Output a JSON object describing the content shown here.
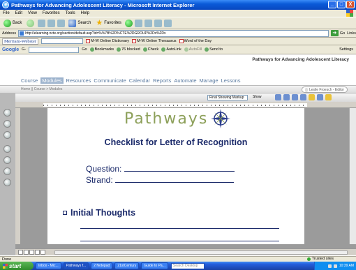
{
  "window": {
    "title": "Pathways for Advancing Adolescent Literacy - Microsoft Internet Explorer",
    "buttons": [
      "_",
      "□",
      "X"
    ]
  },
  "menu": [
    "File",
    "Edit",
    "View",
    "Favorites",
    "Tools",
    "Help"
  ],
  "toolbar": {
    "back": "Back",
    "search": "Search",
    "favorites": "Favorites"
  },
  "address": {
    "label": "Address",
    "url": "http://elearning.ncte.org/section/default.asp?id=%%7B%2D%CTE%2DGROUP%2Dx%2Dx",
    "go": "Go",
    "links": "Links"
  },
  "mwbar": {
    "logo": "Merriam-Webster",
    "items": [
      "M-W Online Dictionary",
      "M-W Online Thesaurus",
      "Word of the Day"
    ]
  },
  "googlebar": {
    "logo": "Google",
    "input_label": "G-",
    "go": "Go",
    "items": [
      "Bookmarks",
      "76 blocked",
      "Check",
      "AutoLink",
      "AutoFill",
      "Send to"
    ],
    "settings": "Settings"
  },
  "site": {
    "title": "Pathways for Advancing Adolescent Literacy",
    "nav": [
      {
        "label": "Course",
        "active": false
      },
      {
        "label": "Modules",
        "active": true
      },
      {
        "label": "Resources",
        "active": false
      },
      {
        "label": "Communicate",
        "active": false
      },
      {
        "label": "Calendar",
        "active": false
      },
      {
        "label": "Reports",
        "active": false
      },
      {
        "label": "Automate",
        "active": false
      },
      {
        "label": "Manage",
        "active": false
      },
      {
        "label": "Lessons",
        "active": false
      }
    ],
    "breadcrumb": "Home || Course > Modules",
    "user_tag": "",
    "user_label": "Leslie Froesch - Editor"
  },
  "word": {
    "markup_select": "Final Showing Markup",
    "show_label": "Show"
  },
  "doc": {
    "logo_text": "Pathways",
    "title": "Checklist for Letter of Recognition",
    "question_label": "Question:",
    "strand_label": "Strand:",
    "section_title": "Initial Thoughts"
  },
  "status": {
    "left": "Done",
    "zone": "Trusted sites"
  },
  "taskbar": {
    "start": "start",
    "tasks": [
      "Inbox - Mic...",
      "Pathways f...",
      "2 Notepad",
      "21stCentury",
      "Guide to Pa..."
    ],
    "search_placeholder": "Search Desktop",
    "clock": "10:39 AM"
  }
}
